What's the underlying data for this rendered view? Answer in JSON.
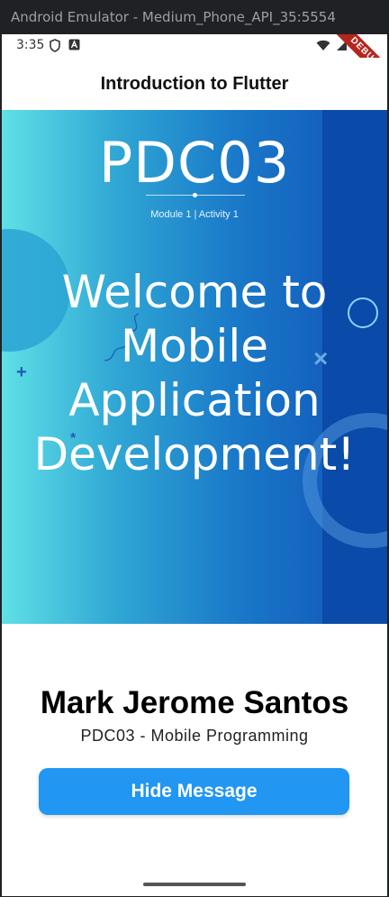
{
  "window": {
    "title": "Android Emulator - Medium_Phone_API_35:5554"
  },
  "status_bar": {
    "time": "3:35",
    "left_icons": [
      "shield-icon",
      "app-notification-icon"
    ],
    "right_icons": [
      "wifi-icon",
      "signal-icon",
      "battery-icon"
    ],
    "debug_label": "DEBUG"
  },
  "app_bar": {
    "title": "Introduction to Flutter"
  },
  "banner": {
    "logo_text": "PDC03",
    "subtitle": "Module 1 | Activity 1",
    "heading": "Welcome to Mobile Application Development!",
    "colors": {
      "gradient_start": "#5fe0e6",
      "gradient_end": "#0f4fb5"
    }
  },
  "profile": {
    "name": "Mark Jerome Santos",
    "course": "PDC03 - Mobile Programming"
  },
  "actions": {
    "hide_label": "Hide Message",
    "accent_color": "#2196f3"
  }
}
